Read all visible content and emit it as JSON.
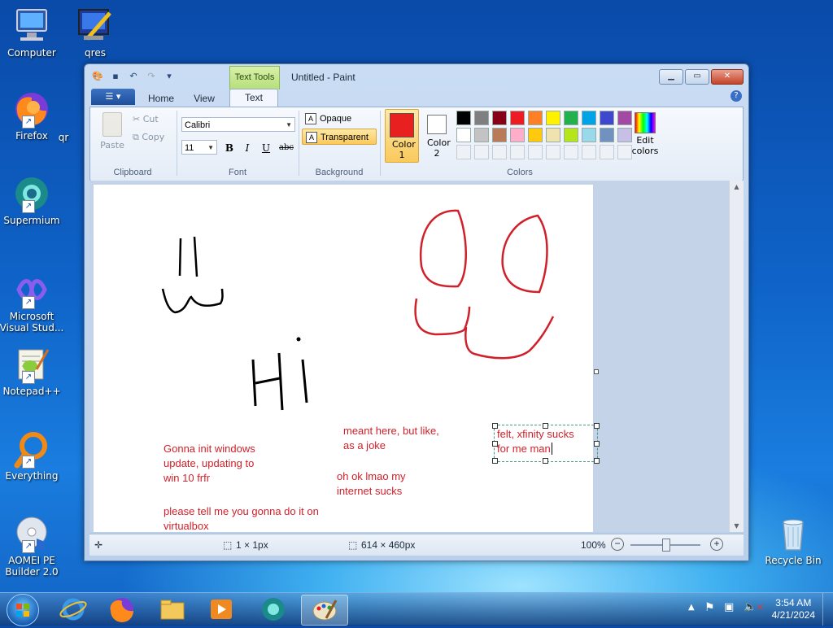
{
  "desktop": {
    "icons": [
      {
        "label": "Computer"
      },
      {
        "label": "qres"
      },
      {
        "label": "Firefox"
      },
      {
        "label": "qr"
      },
      {
        "label": "Supermium"
      },
      {
        "label": "Microsoft Visual Stud..."
      },
      {
        "label": "Notepad++"
      },
      {
        "label": "Everything"
      },
      {
        "label": "AOMEI PE Builder 2.0"
      },
      {
        "label": "Recycle Bin"
      }
    ]
  },
  "window": {
    "title": "Untitled - Paint",
    "contextual_tab": "Text Tools",
    "tabs": [
      "Home",
      "View",
      "Text"
    ],
    "active_tab": "Text"
  },
  "ribbon": {
    "clipboard": {
      "paste": "Paste",
      "cut": "Cut",
      "copy": "Copy",
      "label": "Clipboard"
    },
    "font": {
      "family": "Calibri",
      "size": "11",
      "bold": "B",
      "italic": "I",
      "underline": "U",
      "strike": "abc",
      "label": "Font"
    },
    "background": {
      "opaque": "Opaque",
      "transparent": "Transparent",
      "label": "Background"
    },
    "colors": {
      "color1": "Color 1",
      "color2": "Color 2",
      "edit": "Edit colors",
      "label": "Colors",
      "color1_value": "#e8201f",
      "color2_value": "#ffffff",
      "palette": [
        "#000000",
        "#7f7f7f",
        "#880015",
        "#ed1c24",
        "#ff7f27",
        "#fff200",
        "#22b14c",
        "#00a2e8",
        "#3f48cc",
        "#a349a4",
        "#ffffff",
        "#c3c3c3",
        "#b97a57",
        "#ffaec9",
        "#ffc90e",
        "#efe4b0",
        "#b5e61d",
        "#99d9ea",
        "#7092be",
        "#c8bfe7"
      ]
    }
  },
  "canvas": {
    "texts": [
      {
        "lines": [
          "Gonna init windows",
          "update, updating to",
          "win 10 frfr"
        ]
      },
      {
        "lines": [
          "please tell me you gonna do it on",
          "virtualbox"
        ]
      },
      {
        "lines": [
          "meant here, but like,",
          "as a joke"
        ]
      },
      {
        "lines": [
          "oh ok lmao my",
          "internet sucks"
        ]
      },
      {
        "lines": [
          "felt, xfinity sucks",
          "for me man"
        ]
      }
    ],
    "ink_colors": {
      "black": "#000000",
      "red": "#d0202a"
    }
  },
  "status": {
    "selection": "1 × 1px",
    "canvas_size": "614 × 460px",
    "zoom": "100%"
  },
  "tray": {
    "time": "3:54 AM",
    "date": "4/21/2024"
  }
}
